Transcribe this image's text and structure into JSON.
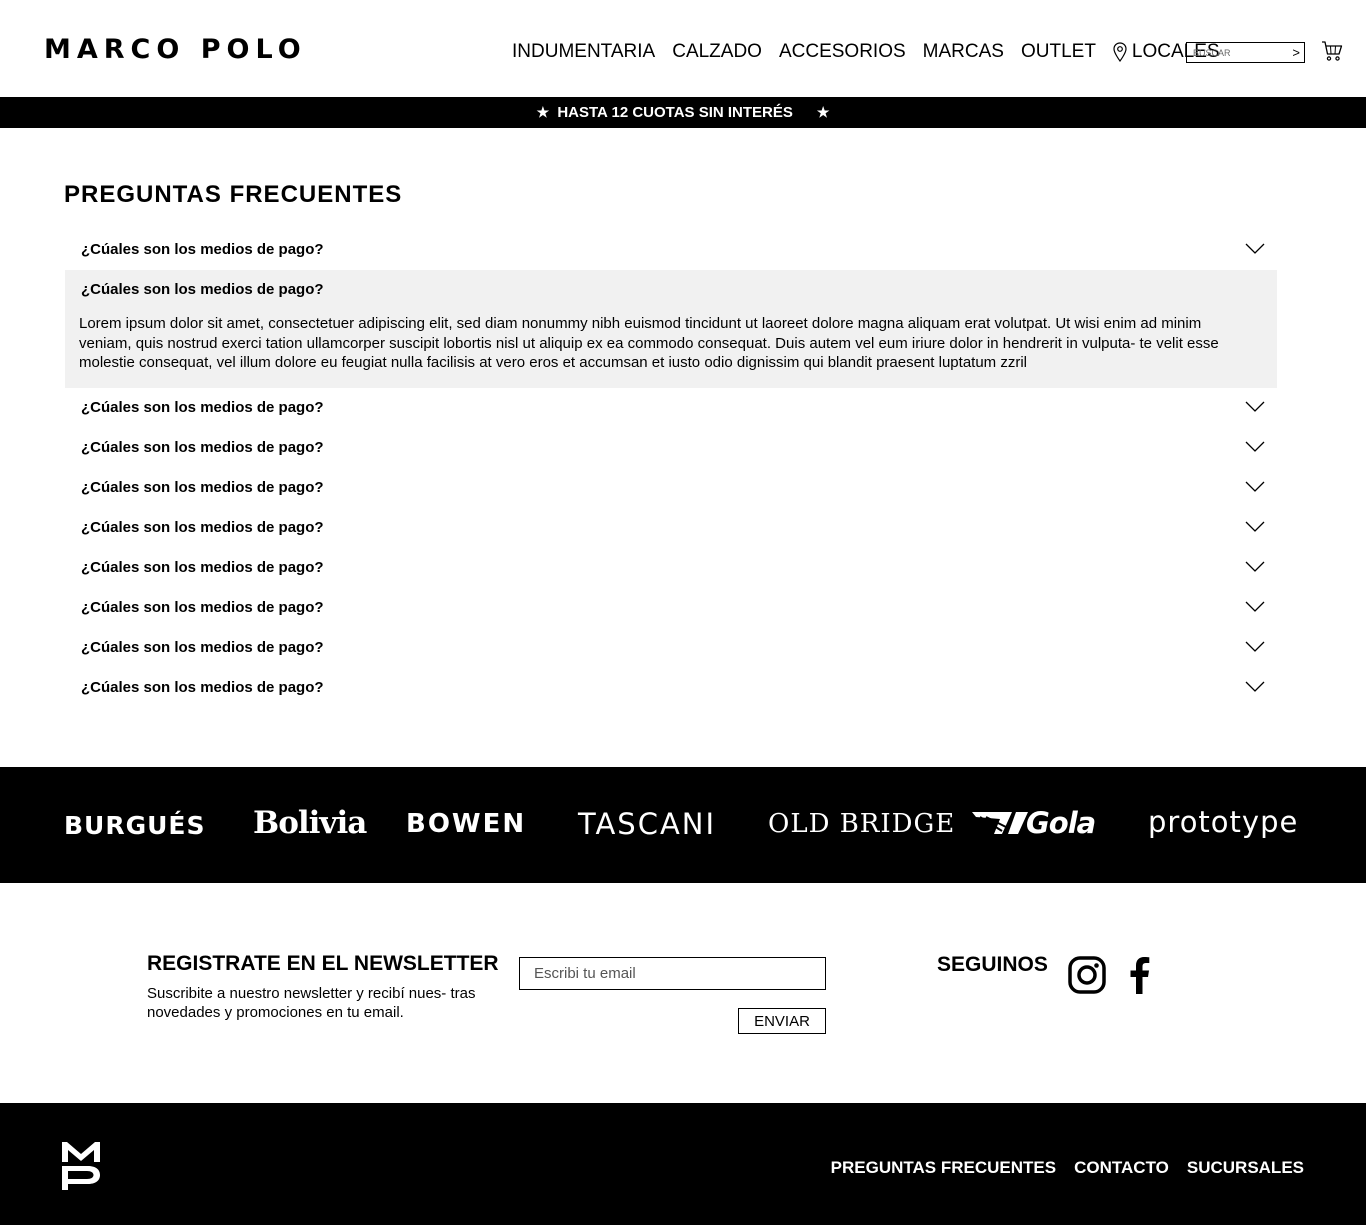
{
  "header": {
    "logo": "MARCO POLO",
    "nav": [
      "INDUMENTARIA",
      "CALZADO",
      "ACCESORIOS",
      "MARCAS",
      "OUTLET"
    ],
    "locales": "LOCALES",
    "search_placeholder": "BUSCAR",
    "search_go": ">"
  },
  "promo": {
    "text": "HASTA 12 CUOTAS SIN INTERÉS",
    "star": "★"
  },
  "faq": {
    "title": "PREGUNTAS FRECUENTES",
    "items": [
      {
        "q": "¿Cúales son los medios de pago?"
      },
      {
        "q": "¿Cúales son los medios de pago?",
        "a": "Lorem ipsum dolor sit amet, consectetuer adipiscing elit, sed diam nonummy nibh euismod tincidunt ut laoreet dolore magna aliquam erat volutpat. Ut wisi enim ad minim veniam, quis nostrud exerci tation ullamcorper suscipit lobortis nisl ut aliquip ex ea commodo consequat. Duis autem vel eum iriure dolor in hendrerit in vulputa- te velit esse molestie consequat, vel illum dolore eu feugiat nulla facilisis at vero eros et accumsan et iusto odio dignissim qui blandit praesent luptatum zzril"
      },
      {
        "q": "¿Cúales son los medios de pago?"
      },
      {
        "q": "¿Cúales son los medios de pago?"
      },
      {
        "q": "¿Cúales son los medios de pago?"
      },
      {
        "q": "¿Cúales son los medios de pago?"
      },
      {
        "q": "¿Cúales son los medios de pago?"
      },
      {
        "q": "¿Cúales son los medios de pago?"
      },
      {
        "q": "¿Cúales son los medios de pago?"
      },
      {
        "q": "¿Cúales son los medios de pago?"
      }
    ]
  },
  "brands": [
    "BURGUÉS",
    "Bolivia",
    "BOWEN",
    "TASCANI",
    "OLD BRIDGE",
    "Gola",
    "prototype"
  ],
  "newsletter": {
    "title": "REGISTRATE EN EL NEWSLETTER",
    "text": "Suscribite a nuestro newsletter y recibí nues- tras novedades y promociones en tu email.",
    "placeholder": "Escribi tu email",
    "button": "ENVIAR"
  },
  "social": {
    "title": "SEGUINOS",
    "icons": [
      "instagram-icon",
      "facebook-icon"
    ]
  },
  "footer": {
    "logo": "MP",
    "links": [
      "PREGUNTAS FRECUENTES",
      "CONTACTO",
      "SUCURSALES"
    ]
  },
  "colors": {
    "dark": "#000000",
    "light": "#ffffff",
    "accordion_open_bg": "#f1f1f1"
  }
}
